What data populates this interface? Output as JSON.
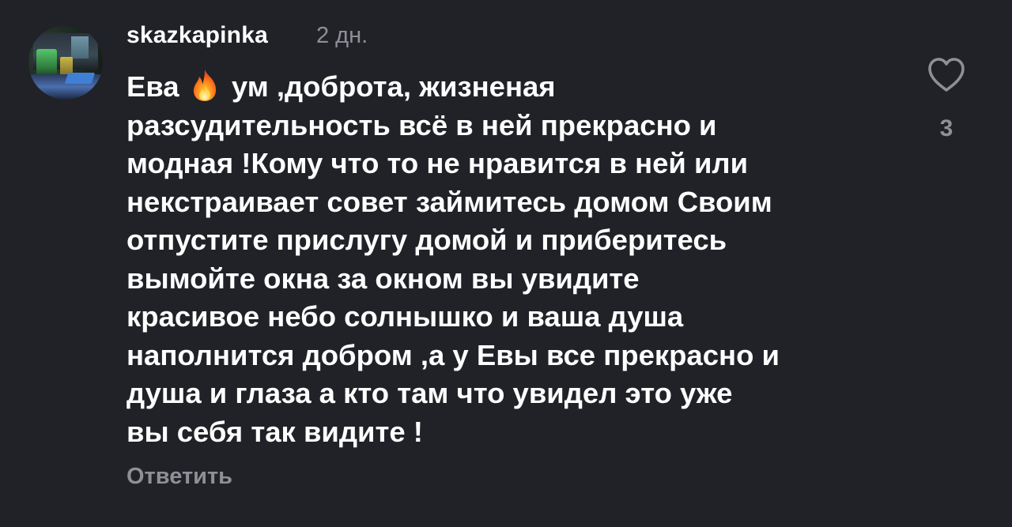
{
  "comment": {
    "username": "skazkapinka",
    "timestamp": "2 дн.",
    "body_lines": [
      {
        "before_emoji": "Ева ",
        "emoji": "fire-icon",
        "after_emoji": " ум ,доброта, жизненая"
      },
      "разсудительность всё в ней прекрасно и",
      "модная !Кому что то не нравится в ней или",
      "некстраивает совет займитесь домом Своим",
      "отпустите прислугу домой и приберитесь",
      "вымойте окна за окном вы увидите",
      "красивое небо солнышко и ваша душа",
      "наполнится добром ,а у Евы все прекрасно и",
      "душа и глаза а кто там что увидел это уже",
      "вы себя так видите !"
    ],
    "reply_label": "Ответить",
    "like_icon": "heart-outline-icon",
    "like_count": "3"
  },
  "colors": {
    "background": "#202228",
    "text_primary": "#ffffff",
    "text_secondary": "#8e9096"
  }
}
